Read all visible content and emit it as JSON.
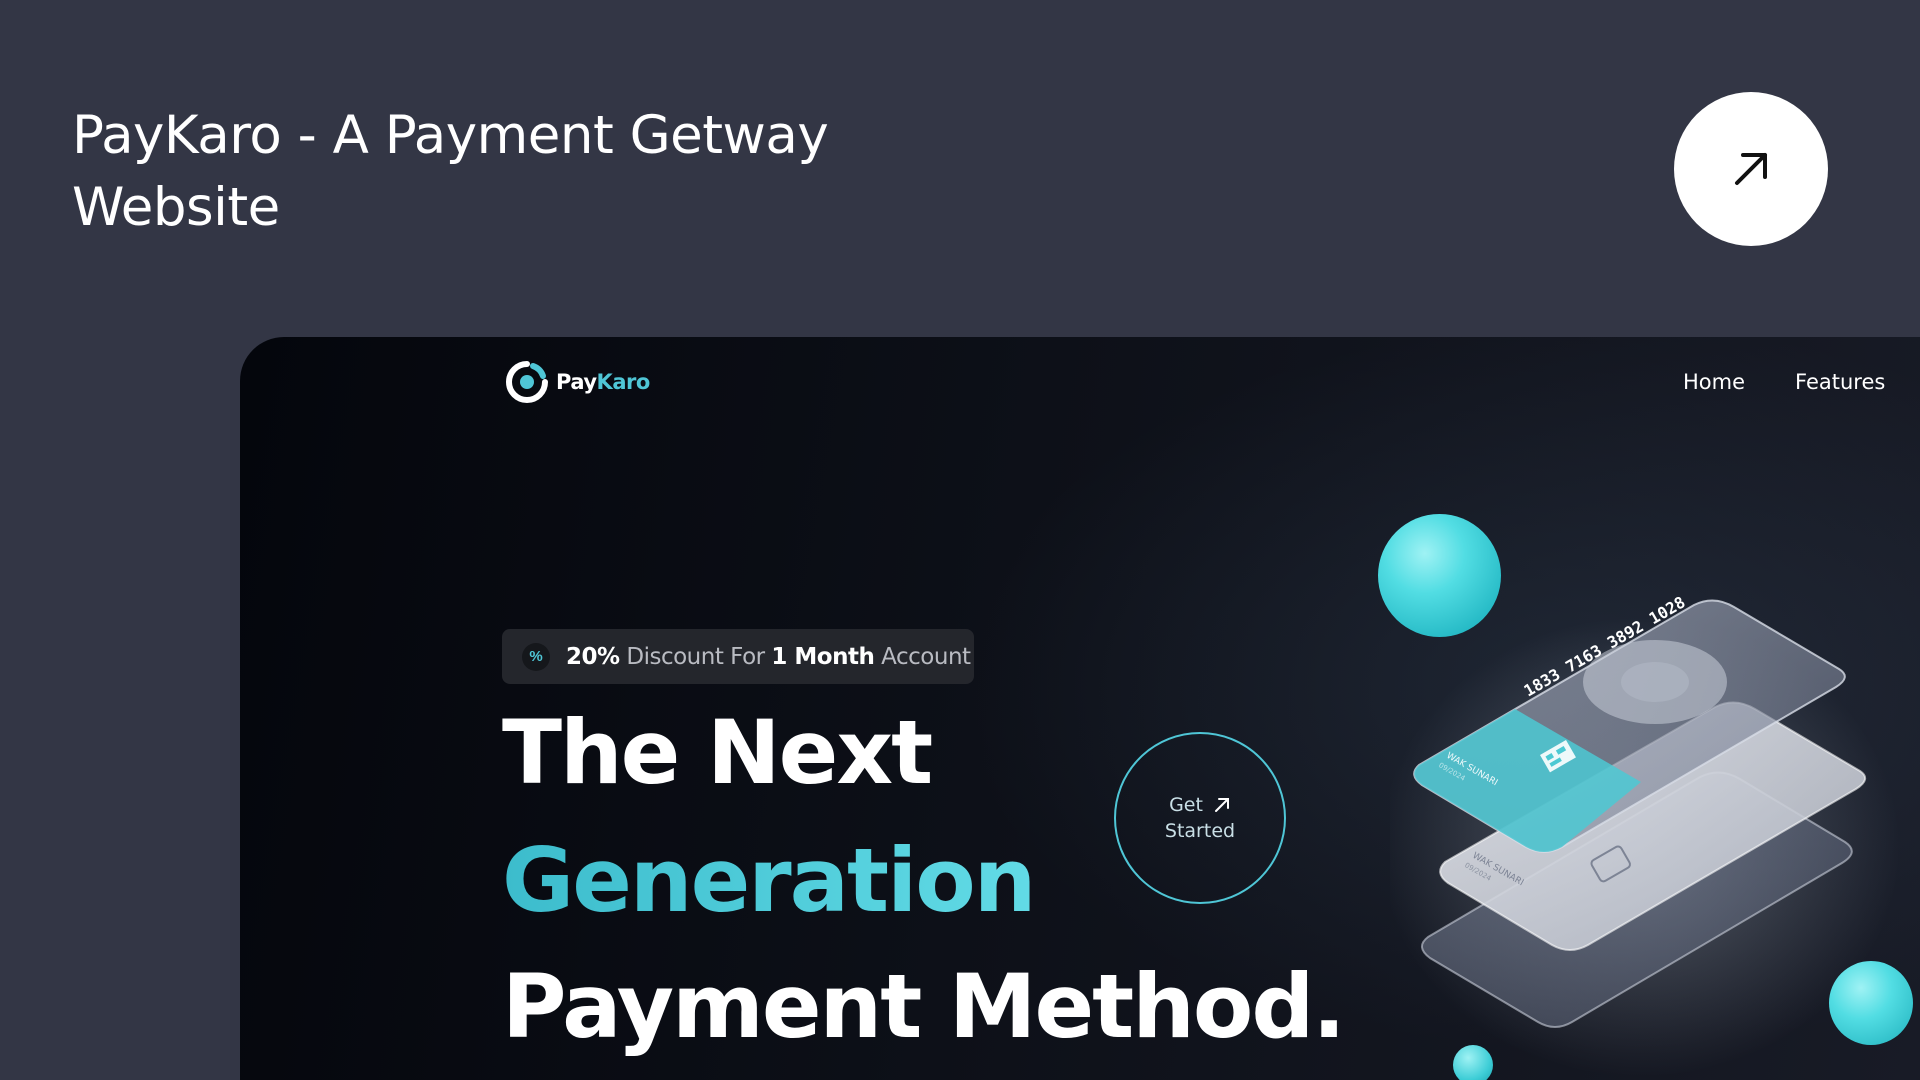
{
  "header": {
    "title_line1": "PayKaro - A Payment Getway",
    "title_line2": "Website",
    "open_icon": "arrow-up-right-icon"
  },
  "site": {
    "logo_pay": "Pay",
    "logo_karo": "Karo",
    "nav": [
      "Home",
      "Features"
    ],
    "badge": {
      "icon": "%",
      "pct": "20%",
      "mid": " Discount For ",
      "month_num": "1 Month",
      "tail": " Account"
    },
    "hero": {
      "line1": "The Next",
      "line2": "Generation",
      "line3": "Payment Method."
    },
    "cta": {
      "line1": "Get",
      "line2": "Started"
    },
    "card": {
      "number": "1833 7163 3892 1028",
      "holder": "WAK SUNARI",
      "expiry": "09/2024"
    }
  },
  "colors": {
    "page_bg": "#333645",
    "accent": "#4fc6d6"
  }
}
